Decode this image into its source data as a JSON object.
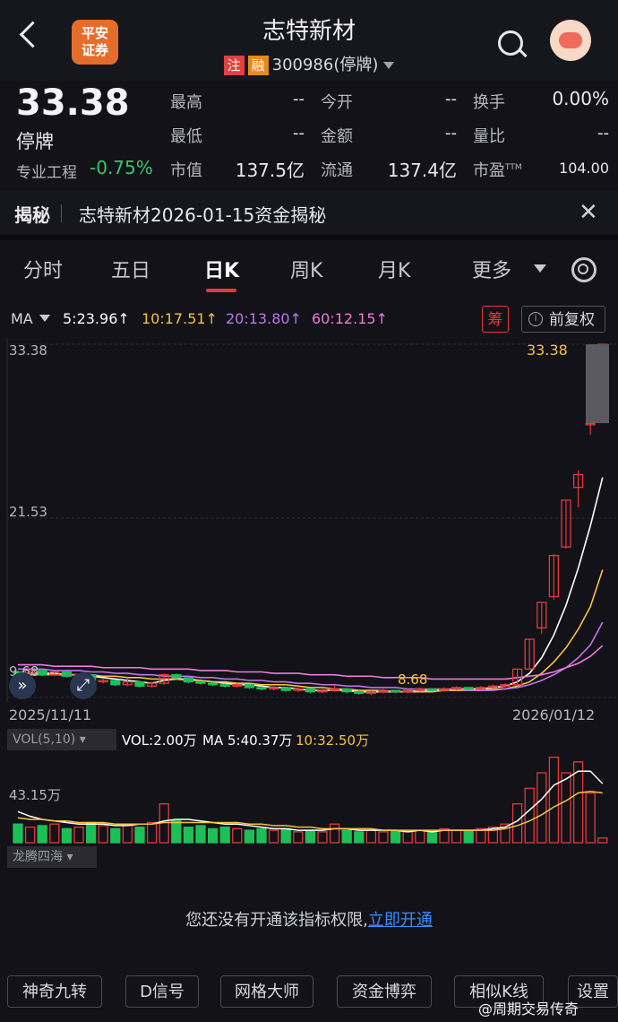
{
  "header": {
    "title": "志特新材",
    "broker_logo_line1": "平安",
    "broker_logo_line2": "证券",
    "tag_zhu": "注",
    "tag_rong": "融",
    "code": "300986",
    "status_paren": "(停牌)"
  },
  "quote": {
    "price": "33.38",
    "status": "停牌",
    "industry": "专业工程",
    "change_pct": "-0.75%",
    "fields": {
      "high_label": "最高",
      "high_value": "--",
      "low_label": "最低",
      "low_value": "--",
      "mcap_label": "市值",
      "mcap_value": "137.5亿",
      "open_label": "今开",
      "open_value": "--",
      "amount_label": "金额",
      "amount_value": "--",
      "float_label": "流通",
      "float_value": "137.4亿",
      "turnover_label": "换手",
      "turnover_value": "0.00%",
      "volratio_label": "量比",
      "volratio_value": "--",
      "pe_label": "市盈",
      "pe_sup": "TTM",
      "pe_value": "104.00"
    }
  },
  "reveal": {
    "label": "揭秘",
    "text": "志特新材2026-01-15资金揭秘",
    "close": "✕"
  },
  "tabs": [
    "分时",
    "五日",
    "日K",
    "周K",
    "月K",
    "更多"
  ],
  "active_tab": "日K",
  "ma": {
    "label": "MA",
    "items": [
      {
        "text": "5:23.96↑",
        "color": "#ffffff"
      },
      {
        "text": "10:17.51↑",
        "color": "#f5c242"
      },
      {
        "text": "20:13.80↑",
        "color": "#c074f0"
      },
      {
        "text": "60:12.15↑",
        "color": "#f07ad8"
      }
    ],
    "chou": "筹",
    "fq": "前复权"
  },
  "chart_data": {
    "type": "candlestick",
    "y_labels": [
      "33.38",
      "21.53",
      "9.68"
    ],
    "high_marker": "33.38",
    "low_marker": "8.68",
    "date_start": "2025/11/11",
    "date_end": "2026/01/12",
    "candles": [
      {
        "o": 10.3,
        "c": 10.2,
        "h": 10.4,
        "l": 10.1
      },
      {
        "o": 10.2,
        "c": 10.4,
        "h": 10.5,
        "l": 10.1
      },
      {
        "o": 10.4,
        "c": 10.1,
        "h": 10.4,
        "l": 10.0
      },
      {
        "o": 10.1,
        "c": 10.3,
        "h": 10.4,
        "l": 10.0
      },
      {
        "o": 10.3,
        "c": 10.0,
        "h": 10.3,
        "l": 9.9
      },
      {
        "o": 10.0,
        "c": 10.1,
        "h": 10.2,
        "l": 9.9
      },
      {
        "o": 10.1,
        "c": 9.6,
        "h": 10.1,
        "l": 9.5
      },
      {
        "o": 9.6,
        "c": 9.7,
        "h": 9.8,
        "l": 9.5
      },
      {
        "o": 9.7,
        "c": 9.4,
        "h": 9.7,
        "l": 9.3
      },
      {
        "o": 9.4,
        "c": 9.6,
        "h": 9.9,
        "l": 9.3
      },
      {
        "o": 9.6,
        "c": 9.3,
        "h": 9.6,
        "l": 9.2
      },
      {
        "o": 9.3,
        "c": 9.5,
        "h": 9.6,
        "l": 9.2
      },
      {
        "o": 9.5,
        "c": 10.1,
        "h": 10.2,
        "l": 9.4
      },
      {
        "o": 10.1,
        "c": 9.9,
        "h": 10.2,
        "l": 9.8
      },
      {
        "o": 9.9,
        "c": 9.6,
        "h": 9.9,
        "l": 9.5
      },
      {
        "o": 9.6,
        "c": 9.5,
        "h": 9.7,
        "l": 9.4
      },
      {
        "o": 9.5,
        "c": 9.4,
        "h": 9.6,
        "l": 9.3
      },
      {
        "o": 9.4,
        "c": 9.3,
        "h": 9.5,
        "l": 9.2
      },
      {
        "o": 9.3,
        "c": 9.4,
        "h": 9.5,
        "l": 9.2
      },
      {
        "o": 9.4,
        "c": 9.2,
        "h": 9.4,
        "l": 9.1
      },
      {
        "o": 9.2,
        "c": 9.1,
        "h": 9.3,
        "l": 9.0
      },
      {
        "o": 9.1,
        "c": 9.2,
        "h": 9.3,
        "l": 9.0
      },
      {
        "o": 9.2,
        "c": 9.0,
        "h": 9.2,
        "l": 8.9
      },
      {
        "o": 9.0,
        "c": 9.1,
        "h": 9.2,
        "l": 8.9
      },
      {
        "o": 9.1,
        "c": 8.9,
        "h": 9.1,
        "l": 8.8
      },
      {
        "o": 8.9,
        "c": 9.0,
        "h": 9.1,
        "l": 8.8
      },
      {
        "o": 9.0,
        "c": 9.1,
        "h": 9.4,
        "l": 8.9
      },
      {
        "o": 9.1,
        "c": 8.9,
        "h": 9.1,
        "l": 8.8
      },
      {
        "o": 8.9,
        "c": 8.8,
        "h": 9.0,
        "l": 8.7
      },
      {
        "o": 8.8,
        "c": 8.9,
        "h": 9.0,
        "l": 8.68
      },
      {
        "o": 8.9,
        "c": 9.0,
        "h": 9.1,
        "l": 8.8
      },
      {
        "o": 9.0,
        "c": 8.9,
        "h": 9.0,
        "l": 8.8
      },
      {
        "o": 8.9,
        "c": 9.0,
        "h": 9.1,
        "l": 8.8
      },
      {
        "o": 9.0,
        "c": 9.1,
        "h": 9.2,
        "l": 8.9
      },
      {
        "o": 9.1,
        "c": 9.0,
        "h": 9.1,
        "l": 8.9
      },
      {
        "o": 9.0,
        "c": 9.1,
        "h": 9.2,
        "l": 8.9
      },
      {
        "o": 9.1,
        "c": 9.2,
        "h": 9.3,
        "l": 9.0
      },
      {
        "o": 9.2,
        "c": 9.1,
        "h": 9.2,
        "l": 9.0
      },
      {
        "o": 9.1,
        "c": 9.2,
        "h": 9.3,
        "l": 9.0
      },
      {
        "o": 9.2,
        "c": 9.3,
        "h": 9.4,
        "l": 9.1
      },
      {
        "o": 9.3,
        "c": 9.4,
        "h": 9.5,
        "l": 9.2
      },
      {
        "o": 9.4,
        "c": 10.5,
        "h": 10.5,
        "l": 9.3
      },
      {
        "o": 10.5,
        "c": 12.6,
        "h": 12.6,
        "l": 10.5
      },
      {
        "o": 13.4,
        "c": 15.2,
        "h": 15.2,
        "l": 13.0
      },
      {
        "o": 15.6,
        "c": 18.5,
        "h": 18.6,
        "l": 15.4
      },
      {
        "o": 19.1,
        "c": 22.4,
        "h": 22.4,
        "l": 19.0
      },
      {
        "o": 23.3,
        "c": 24.2,
        "h": 24.5,
        "l": 21.9
      },
      {
        "o": 27.8,
        "c": 27.8,
        "h": 28.0,
        "l": 27.0
      },
      {
        "o": 30.3,
        "c": 33.38,
        "h": 33.38,
        "l": 30.3
      }
    ],
    "ma_lines": [
      {
        "name": "MA5",
        "color": "#ffffff",
        "values": [
          10.2,
          10.2,
          10.2,
          10.2,
          10.1,
          10.1,
          10.0,
          9.9,
          9.8,
          9.7,
          9.6,
          9.5,
          9.7,
          9.8,
          9.8,
          9.7,
          9.6,
          9.5,
          9.4,
          9.4,
          9.3,
          9.2,
          9.2,
          9.1,
          9.0,
          9.0,
          9.0,
          9.0,
          8.9,
          8.9,
          8.9,
          8.9,
          8.9,
          9.0,
          9.0,
          9.0,
          9.1,
          9.1,
          9.1,
          9.2,
          9.3,
          9.6,
          10.2,
          11.3,
          12.9,
          15.0,
          17.6,
          20.6,
          24.0
        ]
      },
      {
        "name": "MA10",
        "color": "#f5c242",
        "values": [
          10.1,
          10.1,
          10.1,
          10.1,
          10.1,
          10.1,
          10.1,
          10.0,
          10.0,
          9.9,
          9.9,
          9.8,
          9.8,
          9.8,
          9.7,
          9.7,
          9.6,
          9.6,
          9.5,
          9.5,
          9.4,
          9.4,
          9.4,
          9.3,
          9.2,
          9.2,
          9.1,
          9.1,
          9.0,
          9.0,
          9.0,
          8.9,
          8.9,
          8.9,
          8.9,
          9.0,
          9.0,
          9.0,
          9.0,
          9.1,
          9.1,
          9.3,
          9.6,
          10.2,
          11.0,
          12.0,
          13.3,
          14.9,
          17.5
        ]
      },
      {
        "name": "MA20",
        "color": "#c074f0",
        "values": [
          10.5,
          10.5,
          10.5,
          10.4,
          10.4,
          10.4,
          10.3,
          10.3,
          10.2,
          10.2,
          10.1,
          10.1,
          10.0,
          10.0,
          10.0,
          9.9,
          9.9,
          9.8,
          9.8,
          9.7,
          9.7,
          9.6,
          9.6,
          9.5,
          9.5,
          9.4,
          9.4,
          9.3,
          9.3,
          9.2,
          9.2,
          9.2,
          9.1,
          9.1,
          9.1,
          9.1,
          9.1,
          9.0,
          9.0,
          9.0,
          9.1,
          9.2,
          9.4,
          9.7,
          10.1,
          10.6,
          11.3,
          12.2,
          13.8
        ]
      },
      {
        "name": "MA60",
        "color": "#f07ad8",
        "values": [
          10.8,
          10.8,
          10.8,
          10.7,
          10.7,
          10.7,
          10.7,
          10.6,
          10.6,
          10.6,
          10.6,
          10.5,
          10.5,
          10.5,
          10.5,
          10.4,
          10.4,
          10.4,
          10.3,
          10.3,
          10.3,
          10.2,
          10.2,
          10.2,
          10.1,
          10.1,
          10.1,
          10.0,
          10.0,
          10.0,
          9.9,
          9.9,
          9.9,
          9.9,
          9.8,
          9.8,
          9.8,
          9.8,
          9.8,
          9.8,
          9.8,
          9.9,
          10.0,
          10.1,
          10.3,
          10.6,
          10.9,
          11.4,
          12.15
        ]
      }
    ],
    "volume": {
      "label_box": "VOL(5,10)",
      "vol_text": "VOL:2.00万",
      "ma5_text": "MA 5:40.37万",
      "ma10_text": "10:32.50万",
      "axis_label": "43.15万",
      "max": 60,
      "bars": [
        12,
        10,
        11,
        12,
        9,
        10,
        13,
        11,
        9,
        12,
        10,
        13,
        25,
        14,
        10,
        11,
        9,
        10,
        9,
        8,
        9,
        8,
        9,
        7,
        8,
        7,
        12,
        8,
        7,
        8,
        7,
        8,
        7,
        8,
        7,
        9,
        8,
        8,
        9,
        10,
        12,
        25,
        35,
        45,
        55,
        45,
        52,
        32,
        3
      ],
      "ma5": [
        20,
        17,
        15,
        14,
        13,
        12,
        12,
        12,
        11,
        11,
        12,
        12,
        14,
        15,
        15,
        14,
        13,
        12,
        12,
        11,
        10,
        9,
        9,
        8,
        8,
        8,
        9,
        9,
        8,
        8,
        8,
        8,
        7,
        8,
        7,
        8,
        8,
        8,
        8,
        9,
        10,
        14,
        21,
        28,
        37,
        41,
        46,
        46,
        38
      ],
      "ma10": [
        16,
        15,
        15,
        14,
        14,
        13,
        13,
        13,
        12,
        12,
        12,
        12,
        13,
        13,
        13,
        13,
        13,
        13,
        13,
        12,
        12,
        11,
        11,
        10,
        10,
        9,
        9,
        9,
        9,
        9,
        8,
        8,
        8,
        8,
        8,
        8,
        8,
        8,
        8,
        8,
        9,
        11,
        14,
        18,
        23,
        27,
        32,
        33,
        32
      ]
    }
  },
  "indicator": {
    "box": "龙腾四海",
    "no_perm": "您还没有开通该指标权限,",
    "open_link": "立即开通"
  },
  "bottom_buttons": [
    "神奇九转",
    "D信号",
    "网格大师",
    "资金博弈",
    "相似K线",
    "设置"
  ],
  "watermark": "@周期交易传奇",
  "colors": {
    "up": "#e33b3b",
    "down": "#1fbf57",
    "accent": "#3b8cff"
  }
}
